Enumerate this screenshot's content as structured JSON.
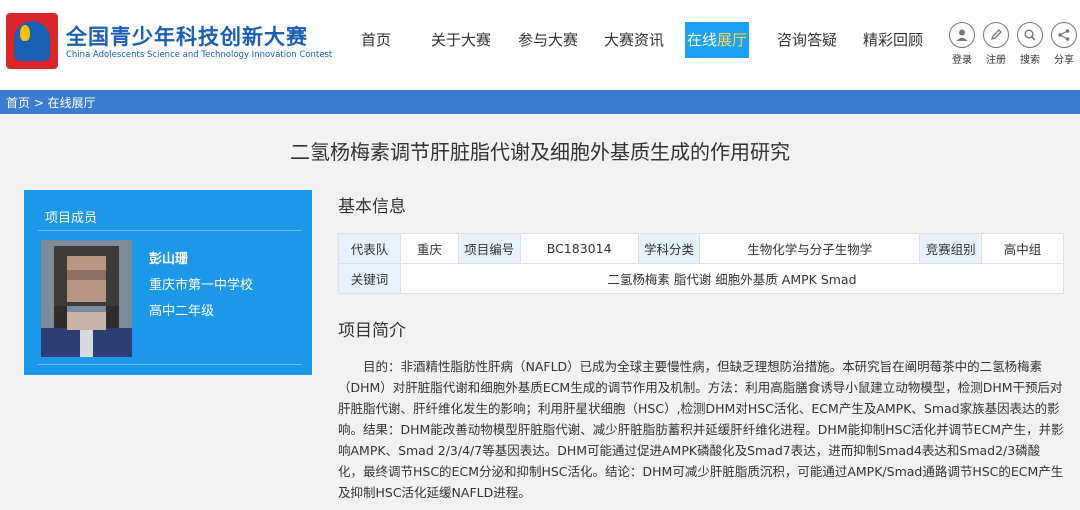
{
  "header": {
    "site_title": "全国青少年科技创新大赛",
    "site_subtitle": "China Adolescents Science and Technology Innovation Contest",
    "nav": [
      {
        "label": "首页"
      },
      {
        "label": "关于大赛"
      },
      {
        "label": "参与大赛"
      },
      {
        "label": "大赛资讯"
      },
      {
        "label_a": "在线",
        "label_b": "展厅",
        "active": true
      },
      {
        "label": "咨询答疑"
      },
      {
        "label": "精彩回顾"
      }
    ],
    "tools": [
      {
        "label": "登录",
        "icon": "user-icon"
      },
      {
        "label": "注册",
        "icon": "pencil-icon"
      },
      {
        "label": "搜索",
        "icon": "search-icon"
      },
      {
        "label": "分享",
        "icon": "share-icon"
      }
    ]
  },
  "breadcrumb": "首页 > 在线展厅",
  "project": {
    "title": "二氢杨梅素调节肝脏脂代谢及细胞外基质生成的作用研究",
    "members_heading": "项目成员",
    "member": {
      "name": "彭山珊",
      "school": "重庆市第一中学校",
      "grade": "高中二年级"
    },
    "basic_info_heading": "基本信息",
    "info": {
      "team_label": "代表队",
      "team_value": "重庆",
      "id_label": "项目编号",
      "id_value": "BC183014",
      "subject_label": "学科分类",
      "subject_value": "生物化学与分子生物学",
      "group_label": "竞赛组别",
      "group_value": "高中组",
      "keywords_label": "关键词",
      "keywords_value": "二氢杨梅素 脂代谢 细胞外基质 AMPK Smad"
    },
    "abstract_heading": "项目简介",
    "abstract": "目的：非酒精性脂肪性肝病（NAFLD）已成为全球主要慢性病，但缺乏理想防治措施。本研究旨在阐明莓茶中的二氢杨梅素（DHM）对肝脏脂代谢和细胞外基质ECM生成的调节作用及机制。方法：利用高脂膳食诱导小鼠建立动物模型，检测DHM干预后对肝脏脂代谢、肝纤维化发生的影响；利用肝星状细胞（HSC）,检测DHM对HSC活化、ECM产生及AMPK、Smad家族基因表达的影响。结果：DHM能改善动物模型肝脏脂代谢、减少肝脏脂肪蓄积并延缓肝纤维化进程。DHM能抑制HSC活化并调节ECM产生，并影响AMPK、Smad 2/3/4/7等基因表达。DHM可能通过促进AMPK磷酸化及Smad7表达，进而抑制Smad4表达和Smad2/3磷酸化，最终调节HSC的ECM分泌和抑制HSC活化。结论：DHM可减少肝脏脂质沉积，可能通过AMPK/Smad通路调节HSC的ECM产生及抑制HSC活化延缓NAFLD进程。"
  },
  "colors": {
    "brand_blue": "#1a5fb4",
    "nav_active": "#1da1f2",
    "breadcrumb_bar": "#3b7cd2",
    "member_card": "#1d97e8",
    "logo_red": "#d9262b"
  }
}
